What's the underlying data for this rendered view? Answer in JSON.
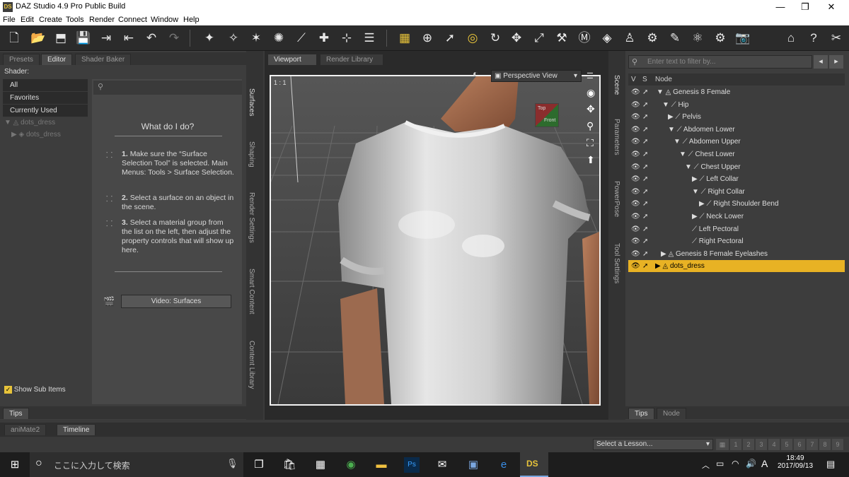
{
  "app": {
    "title": "DAZ Studio 4.9 Pro Public Build",
    "logo": "DS"
  },
  "menu": [
    "File",
    "Edit",
    "Create",
    "Tools",
    "Render",
    "Connect",
    "Window",
    "Help"
  ],
  "left_panel": {
    "tabs": [
      "Presets",
      "Editor",
      "Shader Baker"
    ],
    "shader_label": "Shader:",
    "shader_filters": [
      "All",
      "Favorites",
      "Currently Used"
    ],
    "tree": [
      "dots_dress",
      "dots_dress"
    ],
    "lesson_title": "What do I do?",
    "steps": [
      {
        "num": "1.",
        "text": "Make sure the “Surface Selection Tool” is selected. Main Menus: Tools > Surface Selection."
      },
      {
        "num": "2.",
        "text": "Select a surface on an object in the scene."
      },
      {
        "num": "3.",
        "text": "Select a material group from the list on the left, then adjust the property controls that will show up here."
      }
    ],
    "video_button": "Video: Surfaces",
    "show_sub_items": "Show Sub Items",
    "tips_tab": "Tips"
  },
  "left_vertical_tabs": [
    "Surfaces",
    "Shaping",
    "Render Settings",
    "Smart Content",
    "Content Library"
  ],
  "viewport": {
    "tabs": [
      "Viewport",
      "Render Library"
    ],
    "view_select": "Perspective View",
    "aspect": "1 : 1",
    "cube_faces": [
      "Top",
      "Front"
    ]
  },
  "right_vertical_tabs": [
    "Scene",
    "Parameters",
    "PowerPose",
    "Tool Settings"
  ],
  "scene": {
    "filter_placeholder": "Enter text to filter by...",
    "columns": [
      "V",
      "S",
      "Node"
    ],
    "nodes": [
      {
        "label": "Genesis 8 Female"
      },
      {
        "label": "Hip"
      },
      {
        "label": "Pelvis"
      },
      {
        "label": "Abdomen Lower"
      },
      {
        "label": "Abdomen Upper"
      },
      {
        "label": "Chest Lower"
      },
      {
        "label": "Chest Upper"
      },
      {
        "label": "Left Collar"
      },
      {
        "label": "Right Collar"
      },
      {
        "label": "Right Shoulder Bend"
      },
      {
        "label": "Neck Lower"
      },
      {
        "label": "Left Pectoral"
      },
      {
        "label": "Right Pectoral"
      },
      {
        "label": "Genesis 8 Female Eyelashes"
      },
      {
        "label": "dots_dress"
      }
    ],
    "bottom_tabs": [
      "Tips",
      "Node"
    ]
  },
  "timeline": {
    "tabs": [
      "aniMate2",
      "Timeline"
    ]
  },
  "lesson_bar": {
    "select": "Select a Lesson...",
    "pages": [
      "1",
      "2",
      "3",
      "4",
      "5",
      "6",
      "7",
      "8",
      "9"
    ]
  },
  "taskbar": {
    "search_placeholder": "ここに入力して検索",
    "time": "18:49",
    "date": "2017/09/13",
    "ime": "A",
    "apps": [
      "task-view",
      "store",
      "calculator",
      "chrome",
      "explorer",
      "photoshop",
      "mail",
      "remote",
      "edge",
      "daz"
    ]
  },
  "colors": {
    "selection": "#e8b224",
    "accent": "#e7c33a"
  }
}
